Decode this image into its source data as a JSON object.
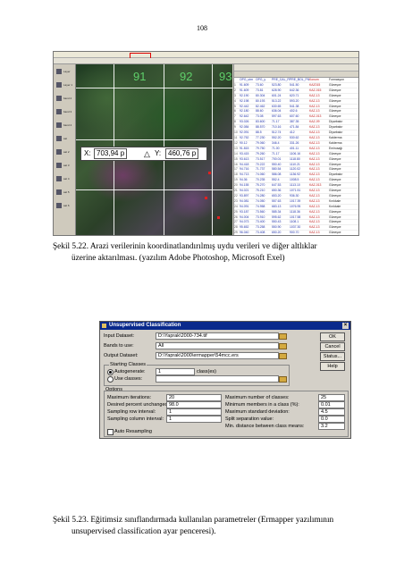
{
  "page_number": "108",
  "figure1": {
    "grid_labels": [
      "91",
      "92",
      "93"
    ],
    "coords": {
      "x_label": "X:",
      "x_value": "703,94 p",
      "y_label": "Y:",
      "y_value": "460,76 p"
    },
    "layers": [
      "Layer",
      "Layer 1",
      "band 2",
      "band 3",
      "band 4",
      "sat",
      "sat 2",
      "sat 3",
      "sat 4",
      "sat 5",
      "sat 6"
    ],
    "excel_header": [
      "",
      "OPG_utm",
      "OPG_y",
      "PRE_CAL_FN",
      "PRE_BOL_FN",
      "Konum",
      "Formasyon"
    ],
    "excel_rows": [
      [
        "1",
        "91.609",
        "73.60",
        "523.80",
        "541.50",
        "KAZ015",
        "Güneşce"
      ],
      [
        "2",
        "91.609",
        "73.81",
        "628.90",
        "642.36",
        "KAZ-015",
        "Güneşce"
      ],
      [
        "3",
        "92.190",
        "80.304",
        "601.24",
        "620.71",
        "KAZ-13",
        "Güneşce"
      ],
      [
        "4",
        "92.198",
        "80.193",
        "513.22",
        "593.20",
        "KAZ-13",
        "Güneşce"
      ],
      [
        "5",
        "92.442",
        "82.462",
        "630.65",
        "541.38",
        "KAZ-13",
        "Güneşce"
      ],
      [
        "6",
        "92.180",
        "88.60",
        "636.04",
        "402.6",
        "KAZ-13",
        "Güneşce"
      ],
      [
        "7",
        "92.642",
        "73.08",
        "597.63",
        "607.60",
        "KAZ-013",
        "Güneşce"
      ],
      [
        "8",
        "93.026",
        "83.600",
        "71.17",
        "387.35",
        "KAZ-09",
        "Diyarbakır"
      ],
      [
        "9",
        "92.084",
        "88.570",
        "710.16",
        "471.84",
        "KAZ-13",
        "Diyarbakır"
      ],
      [
        "10",
        "92.091",
        "88.5",
        "512.74",
        "412",
        "KAZ-13",
        "Diyarbakır"
      ],
      [
        "11",
        "92.752",
        "77.230",
        "552.20",
        "530.62",
        "KAZ-13",
        "Kalderma"
      ],
      [
        "12",
        "90.12",
        "79.060",
        "346.4",
        "331.26",
        "KAZ-13",
        "Kalderma"
      ],
      [
        "13",
        "91.815",
        "79.750",
        "71.00",
        "401.11",
        "KAZ-13",
        "Emirusağı"
      ],
      [
        "14",
        "93.415",
        "79.260",
        "71.17",
        "1106.16",
        "KAZ-13",
        "Güneşce"
      ],
      [
        "15",
        "93.613",
        "73.517",
        "700.01",
        "1118.80",
        "KAZ-13",
        "Güneşce"
      ],
      [
        "16",
        "94.418",
        "70.222",
        "550.40",
        "1110.21",
        "KAZ-13",
        "Güneşce"
      ],
      [
        "17",
        "94.716",
        "71.737",
        "580.54",
        "1120.02",
        "KAZ-13",
        "Güneşce"
      ],
      [
        "18",
        "94.713",
        "74.060",
        "586.08",
        "1136.92",
        "KAZ-13",
        "Diyarbakır"
      ],
      [
        "19",
        "94.36",
        "70.235",
        "552.4",
        "1008.5",
        "KAZ-13",
        "Güneşce"
      ],
      [
        "20",
        "94.155",
        "75.270",
        "647.53",
        "1113.10",
        "KAZ-013",
        "Güneşce"
      ],
      [
        "21",
        "94.021",
        "75.210",
        "650.36",
        "1071.51",
        "KAZ-13",
        "Güneşce"
      ],
      [
        "22",
        "93.897",
        "74.280",
        "653.20",
        "936.30",
        "KAZ-13",
        "Güneşce"
      ],
      [
        "23",
        "94.081",
        "74.050",
        "557.63",
        "1017.39",
        "KAZ-13",
        "Kırıkkale"
      ],
      [
        "24",
        "94.091",
        "74.958",
        "683.13",
        "1076.95",
        "KAZ-13",
        "Kırıkkale"
      ],
      [
        "25",
        "93.187",
        "73.560",
        "585.34",
        "1118.36",
        "KAZ-13",
        "Güneşce"
      ],
      [
        "26",
        "94.004",
        "73.910",
        "595.62",
        "1017.58",
        "KAZ-13",
        "Güneşce"
      ],
      [
        "27",
        "94.073",
        "73.400",
        "550.43",
        "1108.1",
        "KAZ-13",
        "Güneşce"
      ],
      [
        "28",
        "95.652",
        "73.258",
        "550.90",
        "1037.30",
        "KAZ-13",
        "Güneşce"
      ],
      [
        "29",
        "96.040",
        "73.408",
        "650.20",
        "900.70",
        "KAZ-13",
        "Güneşce"
      ],
      [
        "30",
        "96.028",
        "69.441",
        "551.83",
        "451.10",
        "KAZ-13",
        "Güneşce"
      ],
      [
        "31",
        "96.255",
        "69.693",
        "280.37",
        "480.74",
        "KAZ-13",
        "Güneşce"
      ],
      [
        "32",
        "96.271",
        "69.547",
        "245.26",
        "407.52",
        "KAZ-13",
        "Güneşce"
      ],
      [
        "33",
        "96.274",
        "69.540",
        "717.06",
        "457.26",
        "KAZ-13",
        "Güneşce"
      ],
      [
        "34",
        "96.275",
        "73.327",
        "271.12",
        "486.00",
        "KAZ-13",
        "Güneşce"
      ]
    ]
  },
  "caption1": {
    "line1": "Şekil 5.22. Arazi verilerinin koordinatlandırılmış uydu verileri ve diğer altlıklar",
    "line2": "üzerine aktarılması. (yazılım Adobe Photoshop, Microsoft Exel)"
  },
  "dialog": {
    "title": "Unsupervised Classification",
    "input_dataset_label": "Input Dataset:",
    "input_dataset_value": "D:\\Yaprak\\2000-734.tif",
    "bands_label": "Bands to use:",
    "bands_value": "All",
    "output_dataset_label": "Output Dataset:",
    "output_dataset_value": "D:\\Yaprak\\2000\\ermapper\\54mcc.ers",
    "buttons": [
      "OK",
      "Cancel",
      "Status...",
      "Help"
    ],
    "starting_classes_label": "Starting Classes",
    "autogenerate_label": "Autogenerate:",
    "autogenerate_value": "1",
    "autogenerate_unit": "class(es)",
    "use_classes_label": "Use classes:",
    "options_label": "Options",
    "left_options": [
      {
        "label": "Maximum iterations:",
        "value": "20"
      },
      {
        "label": "Desired percent unchanged:",
        "value": "98.0"
      },
      {
        "label": "Sampling row interval:",
        "value": "1"
      },
      {
        "label": "Sampling column interval:",
        "value": "1"
      }
    ],
    "auto_resampling_label": "Auto Resampling",
    "right_options": [
      {
        "label": "Maximum number of classes:",
        "value": "25"
      },
      {
        "label": "Minimum members in a class (%):",
        "value": "0.01"
      },
      {
        "label": "Maximum standard deviation:",
        "value": "4.5"
      },
      {
        "label": "Split separation value:",
        "value": "0.0"
      },
      {
        "label": "Min. distance between class means:",
        "value": "3.2"
      }
    ]
  },
  "caption2": {
    "line1": "Şekil 5.23. Eğitimsiz sınıflandırmada kullanılan parametreler (Ermapper yazılımının",
    "line2": "unsupervised classification ayar penceresi)."
  }
}
